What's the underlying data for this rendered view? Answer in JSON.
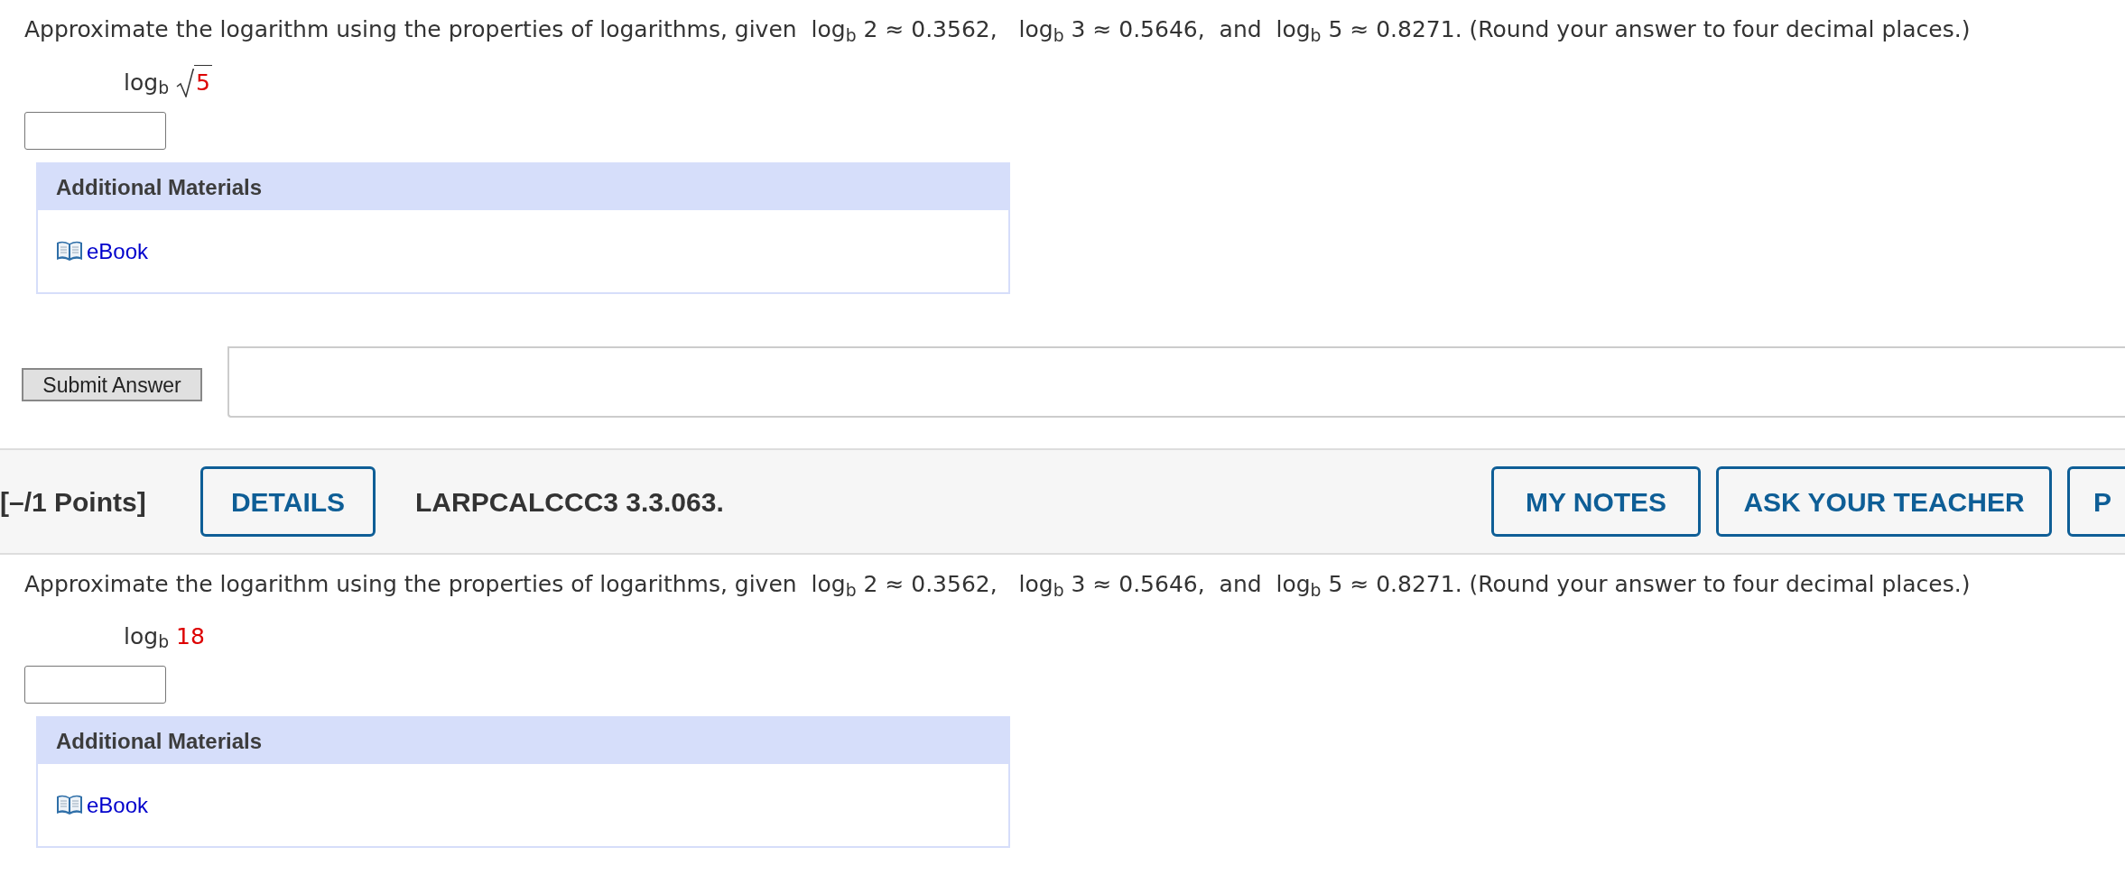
{
  "questions": [
    {
      "prompt": "Approximate the logarithm using the properties of logarithms, given  log$_{b}$ 2 ≈ 0.3562,   log$_{b}$ 3 ≈ 0.5646,  and  log$_{b}$ 5 ≈ 0.8271. (Round your answer to four decimal places.)",
      "expression": {
        "prefix": "log$_{b}$",
        "radical": true,
        "argument": "5"
      },
      "materials": {
        "title": "Additional Materials",
        "links": [
          "eBook"
        ]
      },
      "submit_button": "Submit Answer"
    },
    {
      "header": {
        "points": "[–/1 Points]",
        "details_button": "DETAILS",
        "problem_id": "LARPCALCCC3 3.3.063.",
        "buttons": [
          "MY NOTES",
          "ASK YOUR TEACHER",
          "P"
        ]
      },
      "prompt": "Approximate the logarithm using the properties of logarithms, given  log$_{b}$ 2 ≈ 0.3562,   log$_{b}$ 3 ≈ 0.5646,  and  log$_{b}$ 5 ≈ 0.8271. (Round your answer to four decimal places.)",
      "expression": {
        "prefix": "log$_{b}$",
        "radical": false,
        "argument": "18"
      },
      "materials": {
        "title": "Additional Materials",
        "links": [
          "eBook"
        ]
      }
    }
  ]
}
